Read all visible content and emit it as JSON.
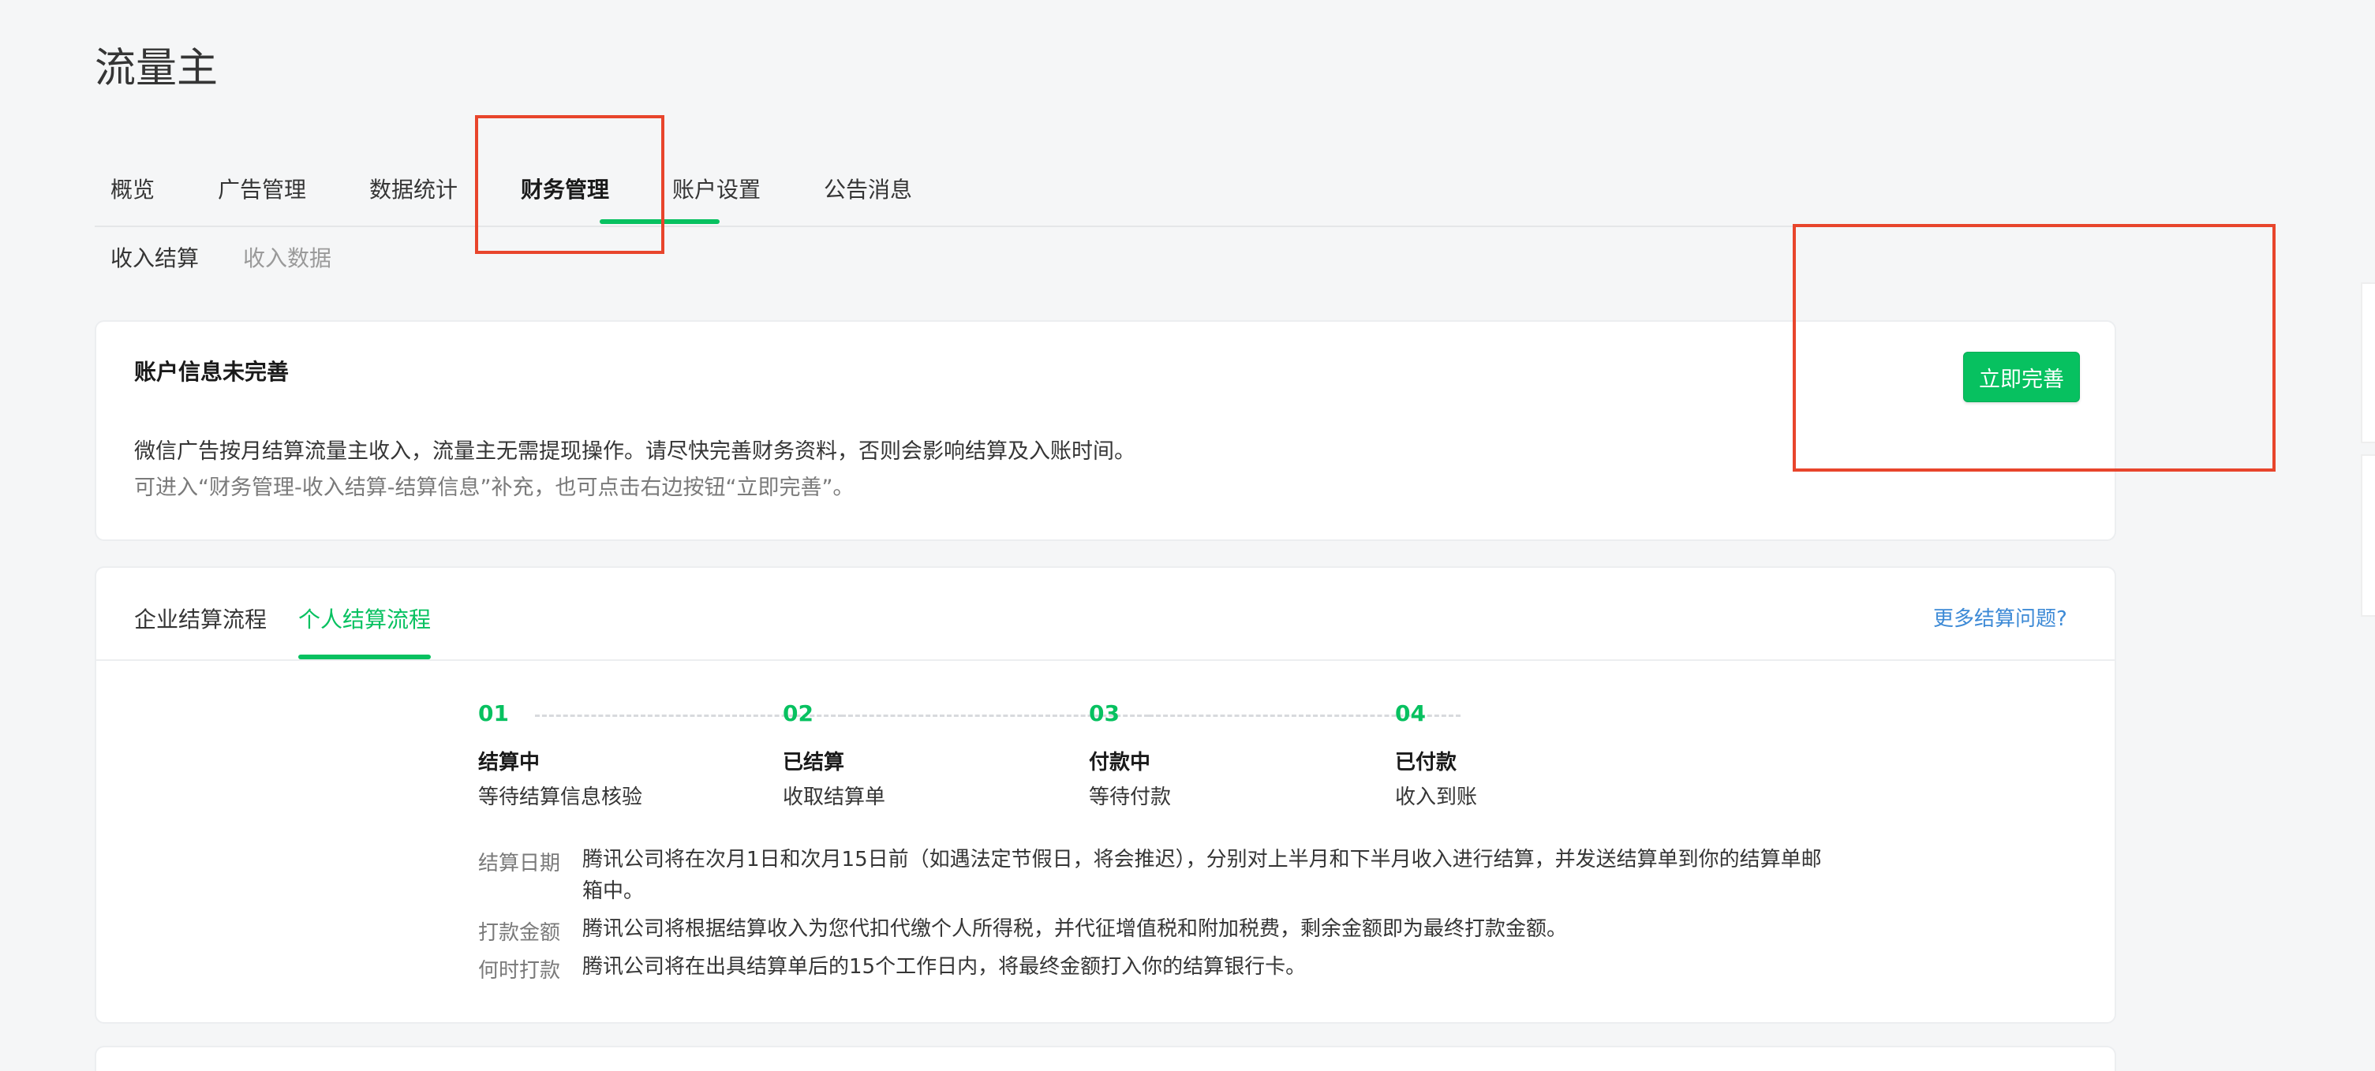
{
  "app": {
    "title": "流量主"
  },
  "main_nav": {
    "tabs": [
      {
        "label": "概览"
      },
      {
        "label": "广告管理"
      },
      {
        "label": "数据统计"
      },
      {
        "label": "财务管理",
        "active": true
      },
      {
        "label": "账户设置"
      },
      {
        "label": "公告消息"
      }
    ]
  },
  "sub_nav": {
    "items": [
      {
        "label": "收入结算",
        "active": true
      },
      {
        "label": "收入数据"
      }
    ]
  },
  "notice": {
    "title": "账户信息未完善",
    "line1": "微信广告按月结算流量主收入，流量主无需提现操作。请尽快完善财务资料，否则会影响结算及入账时间。",
    "line2": "可进入“财务管理-收入结算-结算信息”补充，也可点击右边按钮“立即完善”。",
    "button_label": "立即完善"
  },
  "flow": {
    "tabs": [
      {
        "label": "企业结算流程"
      },
      {
        "label": "个人结算流程",
        "active": true
      }
    ],
    "more_link": "更多结算问题?",
    "steps": [
      {
        "num": "01",
        "title": "结算中",
        "desc": "等待结算信息核验"
      },
      {
        "num": "02",
        "title": "已结算",
        "desc": "收取结算单"
      },
      {
        "num": "03",
        "title": "付款中",
        "desc": "等待付款"
      },
      {
        "num": "04",
        "title": "已付款",
        "desc": "收入到账"
      }
    ],
    "info": [
      {
        "label": "结算日期",
        "text": "腾讯公司将在次月1日和次月15日前（如遇法定节假日，将会推迟），分别对上半月和下半月收入进行结算，并发送结算单到你的结算单邮箱中。"
      },
      {
        "label": "打款金额",
        "text": "腾讯公司将根据结算收入为您代扣代缴个人所得税，并代征增值税和附加税费，剩余金额即为最终打款金额。"
      },
      {
        "label": "何时打款",
        "text": "腾讯公司将在出具结算单后的15个工作日内，将最终金额打入你的结算银行卡。"
      }
    ]
  },
  "colors": {
    "accent": "#07c160",
    "link": "#3d8ad6",
    "annotation": "#e8452c",
    "background": "#f5f6f7"
  }
}
